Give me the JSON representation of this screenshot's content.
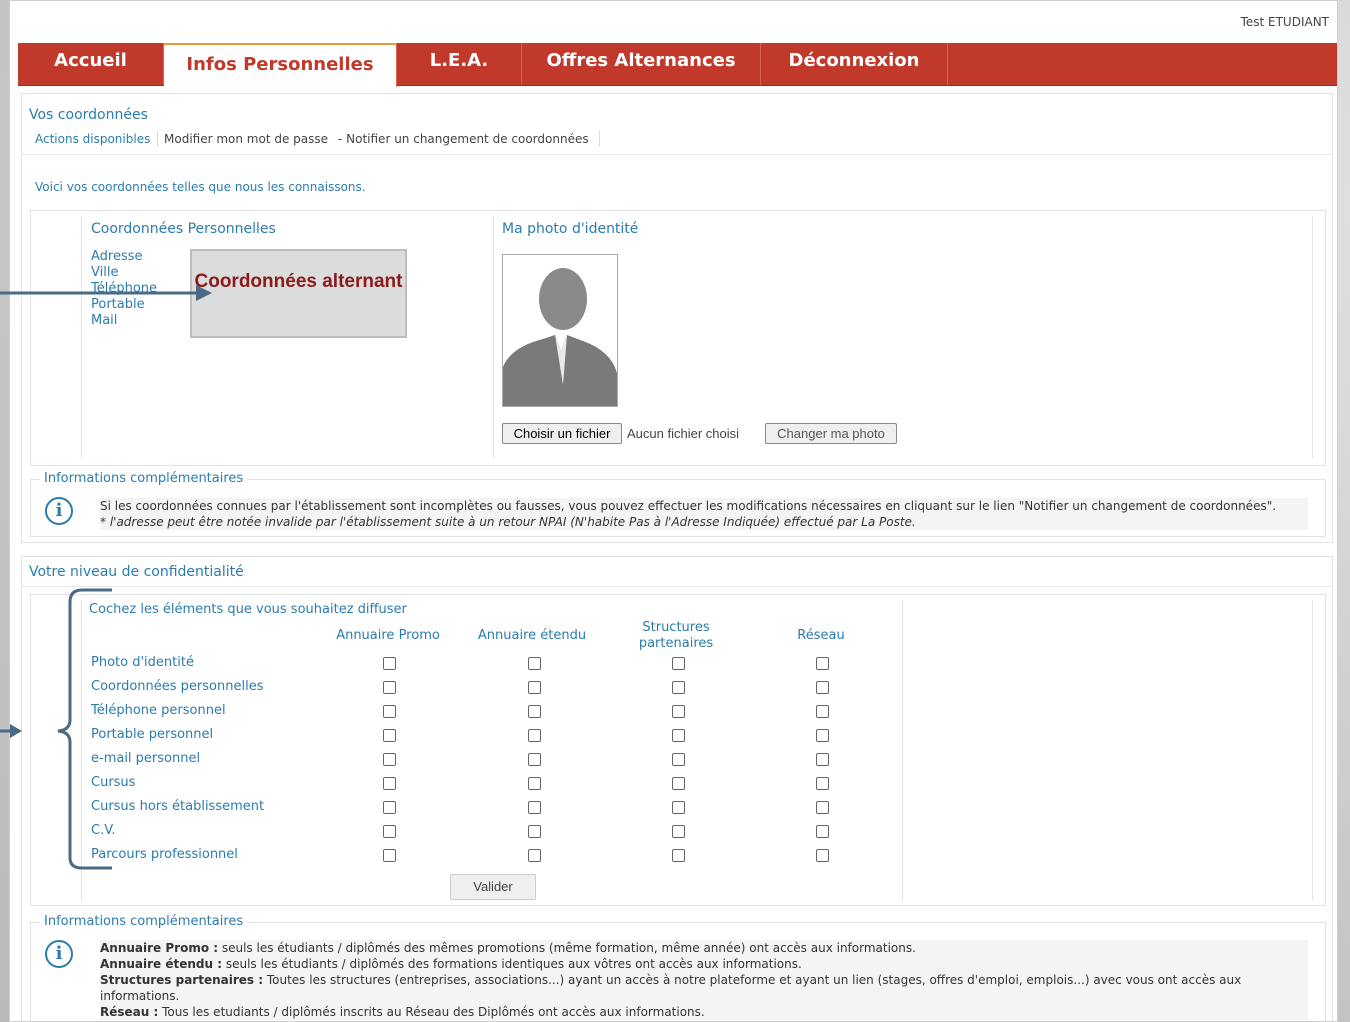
{
  "header": {
    "user": "Test ETUDIANT"
  },
  "nav": {
    "items": [
      {
        "label": "Accueil"
      },
      {
        "label": "Infos Personnelles"
      },
      {
        "label": "L.E.A."
      },
      {
        "label": "Offres Alternances"
      },
      {
        "label": "Déconnexion"
      }
    ],
    "active": "Infos Personnelles"
  },
  "coordonnees": {
    "title": "Vos coordonnées",
    "actions_label": "Actions disponibles",
    "action_password": "Modifier mon mot de passe",
    "action_notify": "- Notifier un changement de coordonnées",
    "intro": "Voici vos coordonnées telles que nous les connaissons.",
    "perso_title": "Coordonnées Personnelles",
    "fields": [
      "Adresse",
      "Ville",
      "Téléphone",
      "Portable",
      "Mail"
    ],
    "callout": "Coordonnées alternant",
    "photo_title": "Ma photo d'identité",
    "file_button": "Choisir un fichier",
    "file_status": "Aucun fichier choisi",
    "change_photo": "Changer ma photo",
    "info_legend": "Informations complémentaires",
    "info_line1": "Si les coordonnées connues par l'établissement sont incomplètes ou fausses, vous pouvez effectuer les modifications nécessaires en cliquant sur le lien \"Notifier un changement de coordonnées\".",
    "info_line2": "* l'adresse peut être notée invalide par l'établissement suite à un retour NPAI (N'habite Pas à l'Adresse Indiquée) effectué par La Poste."
  },
  "confidentialite": {
    "title": "Votre niveau de confidentialité",
    "instruction": "Cochez les éléments que vous souhaitez diffuser",
    "columns": [
      "Annuaire Promo",
      "Annuaire étendu",
      "Structures partenaires",
      "Réseau"
    ],
    "rows": [
      "Photo d'identité",
      "Coordonnées personnelles",
      "Téléphone personnel",
      "Portable personnel",
      "e-mail personnel",
      "Cursus",
      "Cursus hors établissement",
      "C.V.",
      "Parcours professionnel"
    ],
    "validate": "Valider",
    "info_legend": "Informations complémentaires",
    "info": [
      {
        "term": "Annuaire Promo :",
        "text": " seuls les étudiants / diplômés des mêmes promotions (même formation, même année) ont accès aux informations."
      },
      {
        "term": "Annuaire étendu :",
        "text": " seuls les étudiants / diplômés des formations identiques aux vôtres ont accès aux informations."
      },
      {
        "term": "Structures partenaires :",
        "text": " Toutes les structures (entreprises, associations...) ayant un accès à notre plateforme et ayant un lien (stages, offres d'emploi, emplois...) avec vous ont accès aux informations."
      },
      {
        "term": "Réseau :",
        "text": " Tous les etudiants / diplômés inscrits au Réseau des Diplômés ont accès aux informations."
      }
    ]
  },
  "colors": {
    "nav": "#c0392b",
    "accent": "#2b7cad",
    "callout_text": "#8b1a1a"
  },
  "icons": [
    "info-icon",
    "silhouette-icon",
    "arrow-icon",
    "brace-icon"
  ]
}
